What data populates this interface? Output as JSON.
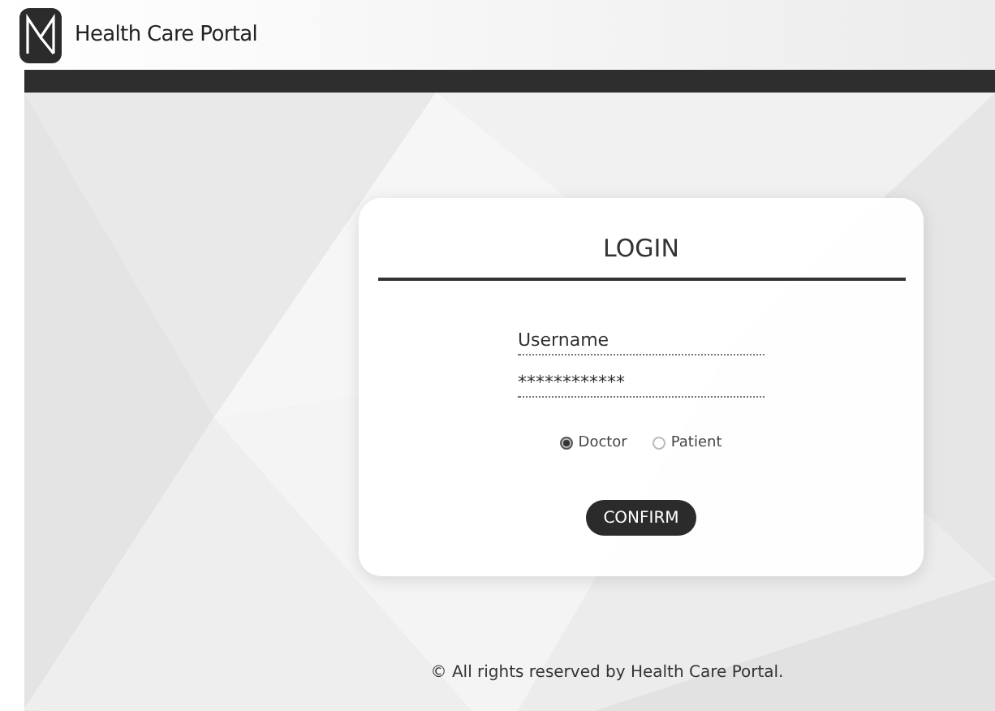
{
  "header": {
    "title": "Health Care Portal"
  },
  "login": {
    "title": "LOGIN",
    "fields": [
      {
        "placeholder": "Username"
      },
      {
        "value": "************"
      }
    ],
    "roles": [
      {
        "label": "Doctor",
        "selected": true
      },
      {
        "label": "Patient",
        "selected": false
      }
    ],
    "button": "CONFIRM"
  },
  "footer": "© All rights reserved by Health Care Portal."
}
